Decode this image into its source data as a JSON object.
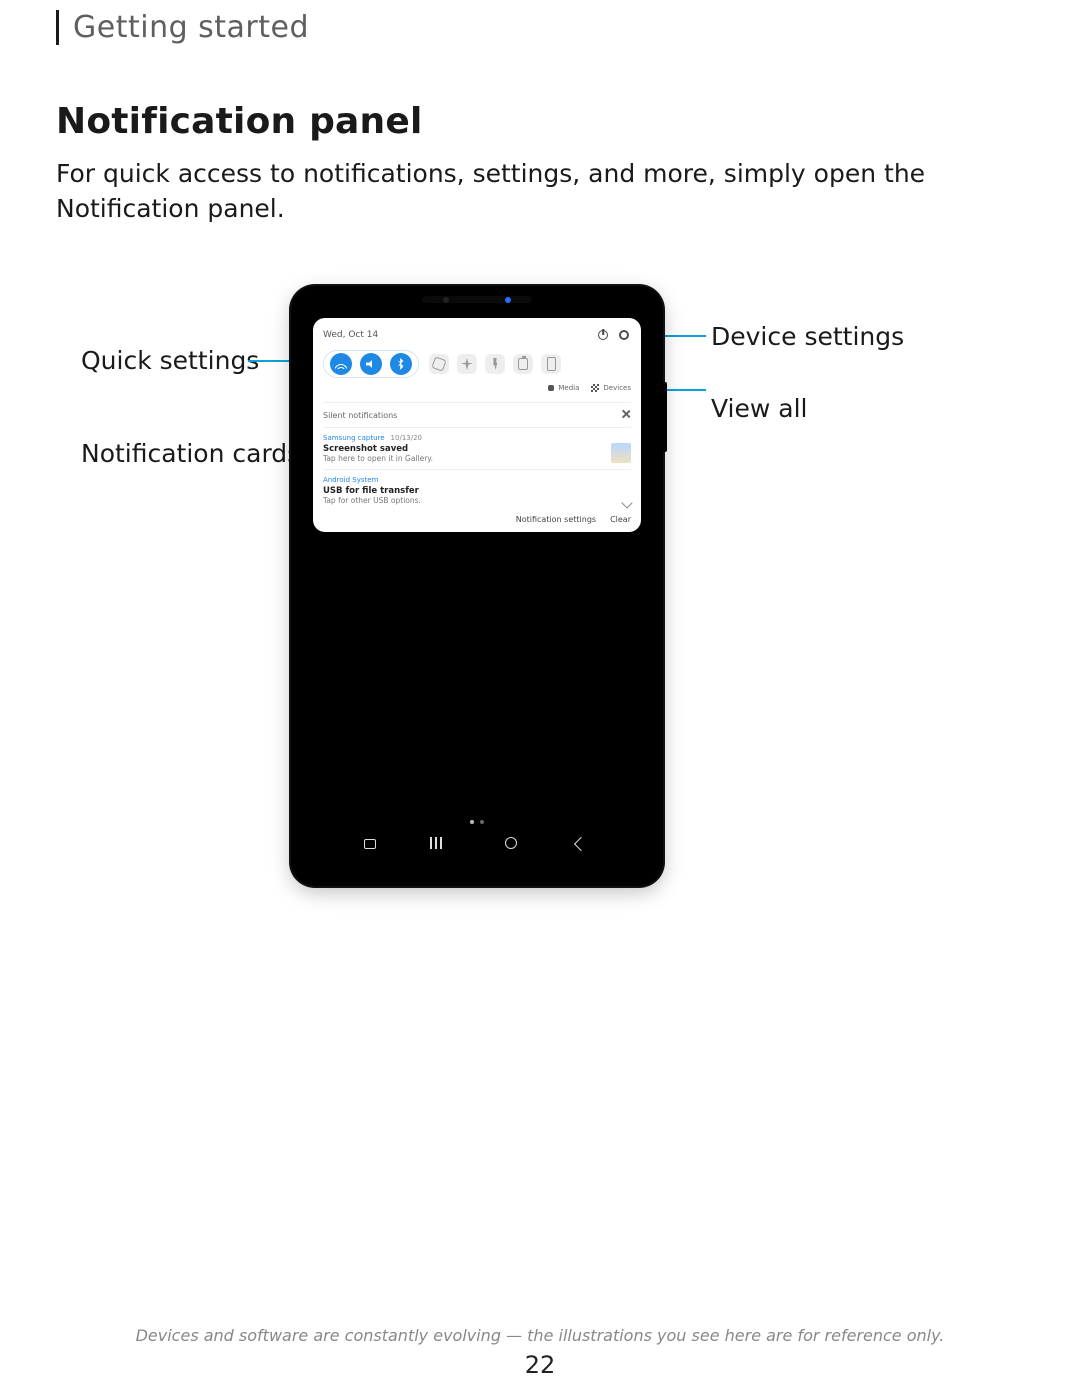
{
  "header": {
    "breadcrumb": "Getting started"
  },
  "section": {
    "title": "Notification panel",
    "lead": "For quick access to notifications, settings, and more, simply open the Notification panel."
  },
  "callouts": {
    "quick_settings": "Quick settings",
    "notification_cards": "Notification cards",
    "device_settings": "Device settings",
    "view_all": "View all"
  },
  "device": {
    "date": "Wed, Oct 14",
    "media_label": "Media",
    "devices_label": "Devices",
    "silent_heading": "Silent notifications",
    "cards": [
      {
        "app": "Samsung capture",
        "timestamp": "10/13/20",
        "title": "Screenshot saved",
        "subtitle": "Tap here to open it in Gallery.",
        "has_thumb": true
      },
      {
        "app": "Android System",
        "timestamp": "",
        "title": "USB for file transfer",
        "subtitle": "Tap for other USB options.",
        "has_thumb": false
      }
    ],
    "footer": {
      "settings": "Notification settings",
      "clear": "Clear"
    },
    "qs_icons": [
      {
        "name": "wifi-icon",
        "on": true
      },
      {
        "name": "volume-icon",
        "on": true
      },
      {
        "name": "bluetooth-icon",
        "on": true
      },
      {
        "name": "rotate-icon",
        "on": false
      },
      {
        "name": "airplane-icon",
        "on": false
      },
      {
        "name": "flashlight-icon",
        "on": false
      },
      {
        "name": "battery-icon",
        "on": false
      },
      {
        "name": "portrait-icon",
        "on": false
      }
    ]
  },
  "footer": {
    "disclaimer": "Devices and software are constantly evolving — the illustrations you see here are for reference only.",
    "page_number": "22"
  }
}
